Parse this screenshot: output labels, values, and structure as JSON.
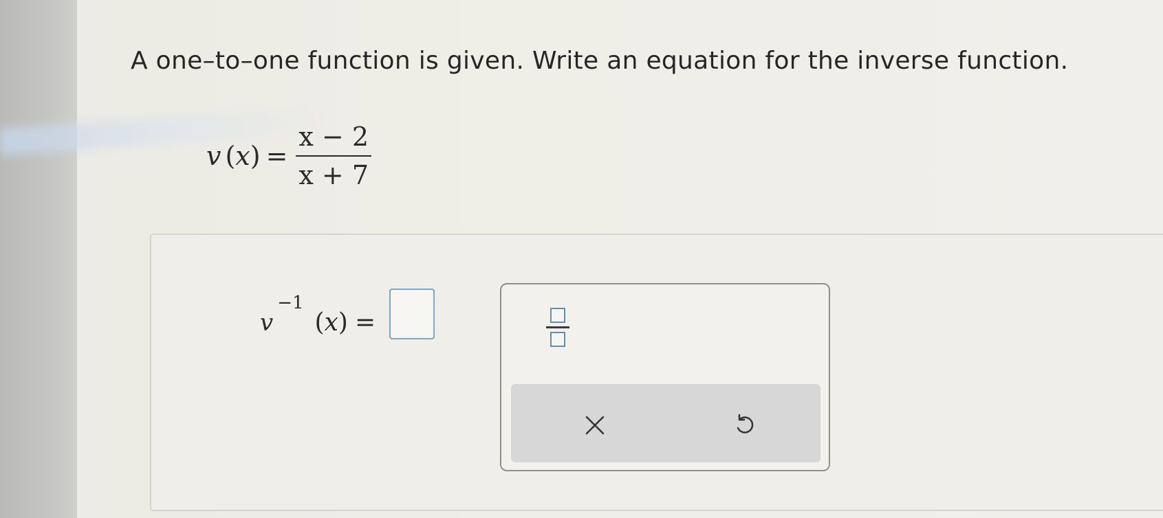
{
  "question": {
    "prompt": "A one–to–one function is given. Write an equation for the inverse function."
  },
  "given_function": {
    "name": "v",
    "argument_open": "(",
    "argument_var": "x",
    "argument_close": ")",
    "equals": "=",
    "numerator": "x − 2",
    "denominator": "x + 7"
  },
  "answer": {
    "name": "v",
    "superscript": "−1",
    "argument_open": "(",
    "argument_var": "x",
    "argument_close": ")",
    "equals": "=",
    "input_value": ""
  },
  "keypad": {
    "fraction_template_icon": "fraction-template-icon",
    "clear_icon": "close-icon",
    "undo_icon": "undo-icon"
  },
  "colors": {
    "input_border": "#7aa7c2",
    "keypad_action_bar": "#d6d7d6"
  }
}
